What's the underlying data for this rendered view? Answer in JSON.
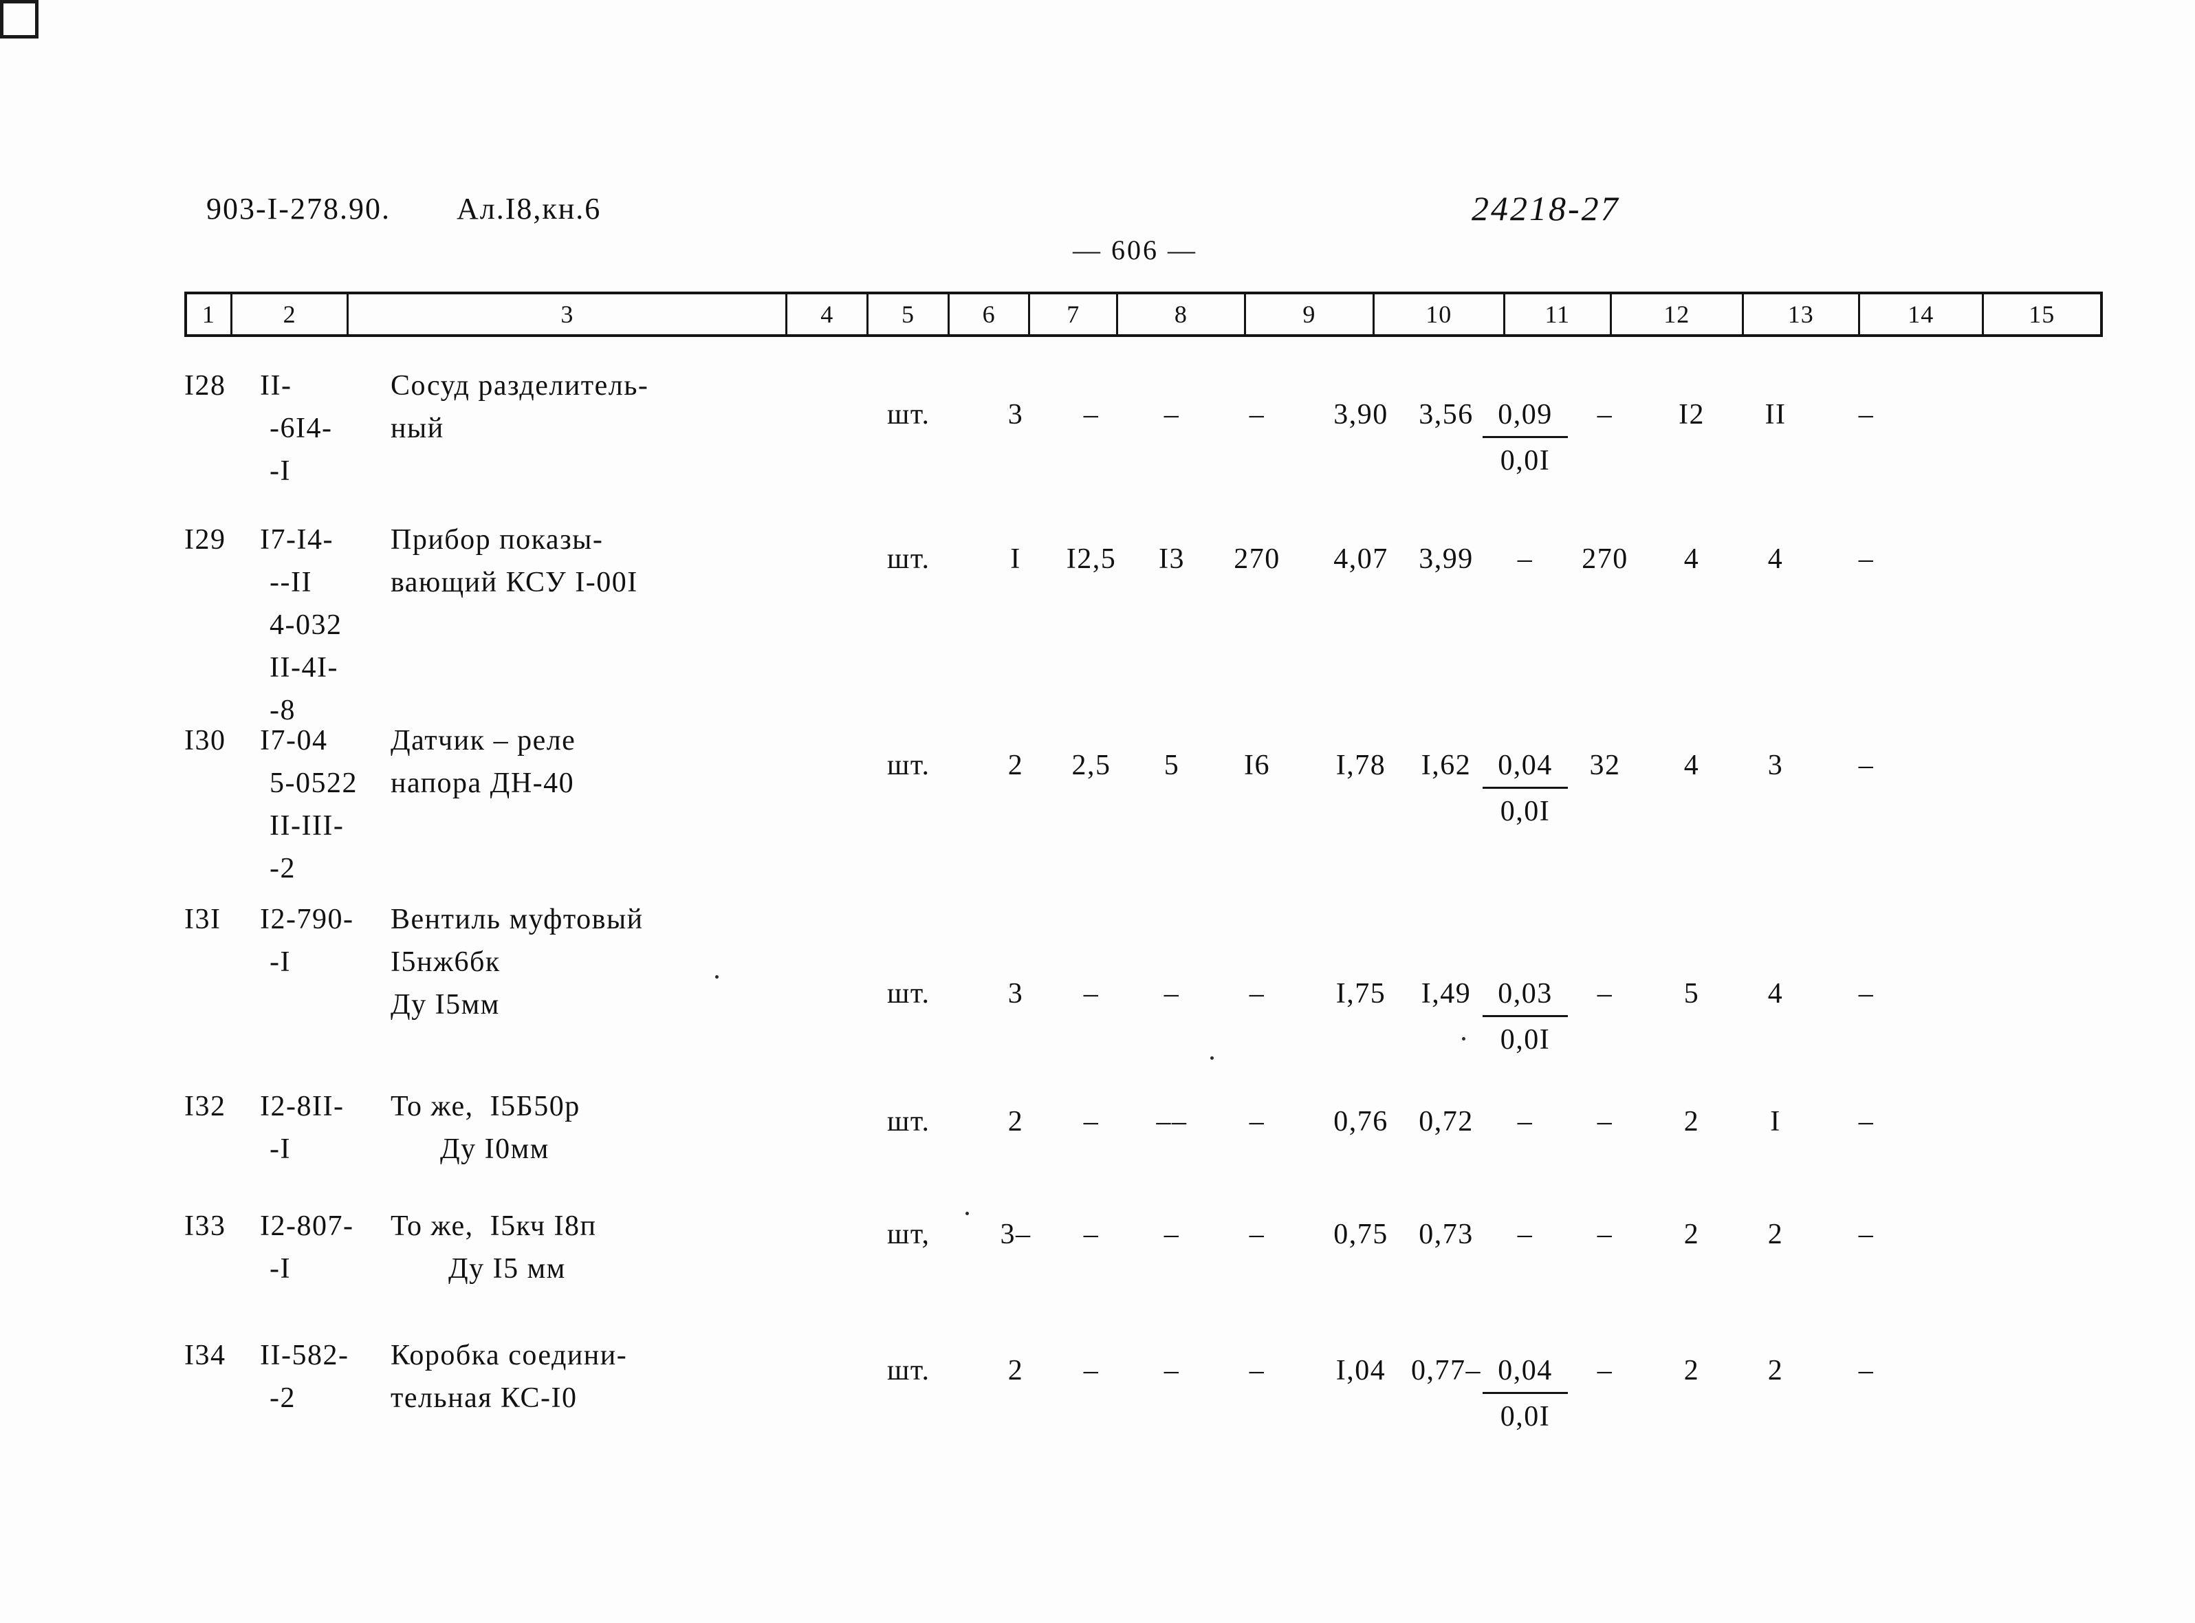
{
  "header": {
    "doc_code": "903-I-278.90.",
    "album": "Ал.I8,кн.6",
    "stamp_number": "24218-27",
    "page_label": "— 606 —"
  },
  "column_headers": [
    "1",
    "2",
    "3",
    "4",
    "5",
    "6",
    "7",
    "8",
    "9",
    "10",
    "11",
    "12",
    "13",
    "14",
    "15"
  ],
  "rows": [
    {
      "num": "I28",
      "code_lines": [
        "II-",
        "-6I4-",
        "-I"
      ],
      "name_lines": [
        "Сосуд разделитель-",
        "ный"
      ],
      "unit": "шт.",
      "c4": "3",
      "c5": "–",
      "c6": "–",
      "c7": "–",
      "c8": "3,90",
      "c9": "3,56",
      "c10_num": "0,09",
      "c10_den": "0,0I",
      "c11": "–",
      "c12": "I2",
      "c13": "II",
      "c14": "–"
    },
    {
      "num": "I29",
      "code_lines": [
        "I7-I4-",
        "--II",
        "4-032",
        "II-4I-",
        "-8"
      ],
      "name_lines": [
        "Прибор показы-",
        "вающий КСУ I-00I"
      ],
      "unit": "шт.",
      "c4": "I",
      "c5": "I2,5",
      "c6": "I3",
      "c7": "270",
      "c8": "4,07",
      "c9": "3,99",
      "c10_num": "–",
      "c10_den": "",
      "c11": "270",
      "c12": "4",
      "c13": "4",
      "c14": "–"
    },
    {
      "num": "I30",
      "code_lines": [
        "I7-04",
        "5-0522",
        "II-III-",
        "-2"
      ],
      "name_lines": [
        "Датчик – реле",
        "напора ДН-40"
      ],
      "unit": "шт.",
      "c4": "2",
      "c5": "2,5",
      "c6": "5",
      "c7": "I6",
      "c8": "I,78",
      "c9": "I,62",
      "c10_num": "0,04",
      "c10_den": "0,0I",
      "c11": "32",
      "c12": "4",
      "c13": "3",
      "c14": "–"
    },
    {
      "num": "I3I",
      "code_lines": [
        "I2-790-",
        "-I"
      ],
      "name_lines": [
        "Вентиль муфтовый",
        "I5нж6бк",
        "Ду I5мм"
      ],
      "unit": "шт.",
      "c4": "3",
      "c5": "–",
      "c6": "–",
      "c7": "–",
      "c8": "I,75",
      "c9": "I,49",
      "c10_num": "0,03",
      "c10_den": "0,0I",
      "c11": "–",
      "c12": "5",
      "c13": "4",
      "c14": "–"
    },
    {
      "num": "I32",
      "code_lines": [
        "I2-8II-",
        "-I"
      ],
      "name_lines": [
        "То же,  I5Б50р",
        "      Ду I0мм"
      ],
      "unit": "шт.",
      "c4": "2",
      "c5": "–",
      "c6": "––",
      "c7": "–",
      "c8": "0,76",
      "c9": "0,72",
      "c10_num": "–",
      "c10_den": "",
      "c11": "–",
      "c12": "2",
      "c13": "I",
      "c14": "–"
    },
    {
      "num": "I33",
      "code_lines": [
        "I2-807-",
        "-I"
      ],
      "name_lines": [
        "То же,  I5кч I8п",
        "       Ду I5 мм"
      ],
      "unit": "шт,",
      "c4": "3–",
      "c5": "–",
      "c6": "–",
      "c7": "–",
      "c8": "0,75",
      "c9": "0,73",
      "c10_num": "–",
      "c10_den": "",
      "c11": "–",
      "c12": "2",
      "c13": "2",
      "c14": "–"
    },
    {
      "num": "I34",
      "code_lines": [
        "II-582-",
        "-2"
      ],
      "name_lines": [
        "Коробка соедини-",
        "тельная КС-I0"
      ],
      "unit": "шт.",
      "c4": "2",
      "c5": "–",
      "c6": "–",
      "c7": "–",
      "c8": "I,04",
      "c9": "0,77–",
      "c10_num": "0,04",
      "c10_den": "0,0I",
      "c11": "–",
      "c12": "2",
      "c13": "2",
      "c14": "–"
    }
  ]
}
